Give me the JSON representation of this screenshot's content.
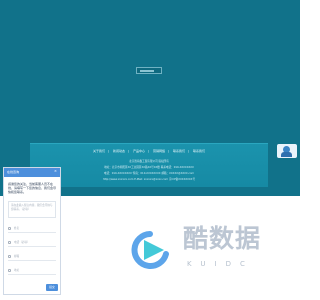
{
  "loading": {
    "progress": 0.7
  },
  "footer": {
    "nav": [
      "关于我们",
      "新闻动态",
      "产品中心",
      "营销网络",
      "联系我们",
      "联系我们"
    ],
    "company": "北京胜海鑫工贸有限公司 版权所有",
    "address": "地址：北京市朝阳区XX工业园区XX路XX号XX楼 联系电话：010-XXXXXXXX",
    "contact": "电话：010-XXXXXXXX 传真：010-XXXXXXXX 邮箱：XXXXX@XXXX.com",
    "web": "http://www.xxxxxx.com E-Mail: xxxxxx@xxxx.com 京ICP备XXXXXXXX号"
  },
  "chat": {
    "title": "在线咨询",
    "close": "×",
    "message": "感谢您的关注，当前客服人员不在线，请填写一下您的信息，我们会尽快和您联系。",
    "area_placeholder": "请在此输入留言内容，我们会尽快与您联系。（必填）",
    "fields": [
      "姓名",
      "电话（必填）",
      "邮箱",
      "地址"
    ],
    "submit": "提交"
  },
  "watermark": {
    "title": "酷数据",
    "subtitle": "KUIDC"
  },
  "colors": {
    "teal": "#11728a",
    "band": "#1b93ad",
    "chat_blue": "#4d8fdc",
    "wm_blue": "#4b9be8",
    "wm_cyan": "#39c6d6"
  },
  "icons": {
    "agent": "customer-service-agent-icon",
    "close": "close-icon",
    "watermark": "play-triangle-logo-icon"
  }
}
